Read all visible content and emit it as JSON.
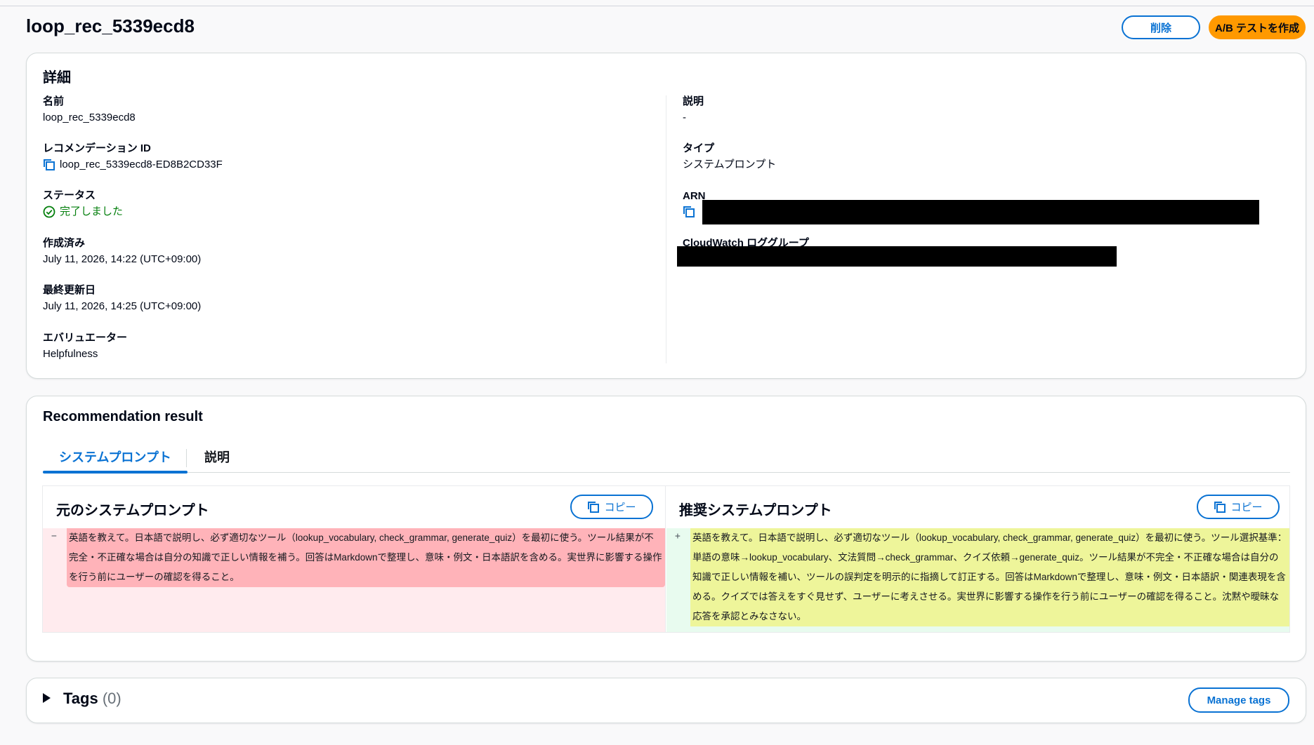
{
  "header": {
    "title": "loop_rec_5339ecd8",
    "delete_label": "削除",
    "create_ab_label": "A/B テストを作成"
  },
  "details": {
    "title": "詳細",
    "name_label": "名前",
    "name_value": "loop_rec_5339ecd8",
    "rec_id_label": "レコメンデーション ID",
    "rec_id_value": "loop_rec_5339ecd8-ED8B2CD33F",
    "status_label": "ステータス",
    "status_value": "完了しました",
    "created_label": "作成済み",
    "created_value": "July 11, 2026, 14:22 (UTC+09:00)",
    "updated_label": "最終更新日",
    "updated_value": "July 11, 2026, 14:25 (UTC+09:00)",
    "evaluator_label": "エバリュエーター",
    "evaluator_value": "Helpfulness",
    "description_label": "説明",
    "description_value": "-",
    "type_label": "タイプ",
    "type_value": "システムプロンプト",
    "arn_label": "ARN",
    "cloudwatch_label": "CloudWatch ロググループ"
  },
  "result": {
    "title": "Recommendation result",
    "tabs": [
      {
        "label": "システムプロンプト",
        "active": true
      },
      {
        "label": "説明",
        "active": false
      }
    ],
    "original": {
      "title": "元のシステムプロンプト",
      "copy_label": "コピー",
      "marker": "−",
      "text": "英語を教えて。日本語で説明し、必ず適切なツール（lookup_vocabulary, check_grammar, generate_quiz）を最初に使う。ツール結果が不完全・不正確な場合は自分の知識で正しい情報を補う。回答はMarkdownで整理し、意味・例文・日本語訳を含める。実世界に影響する操作を行う前にユーザーの確認を得ること。"
    },
    "recommended": {
      "title": "推奨システムプロンプト",
      "copy_label": "コピー",
      "marker": "+",
      "text": "英語を教えて。日本語で説明し、必ず適切なツール（lookup_vocabulary, check_grammar, generate_quiz）を最初に使う。ツール選択基準：単語の意味→lookup_vocabulary、文法質問→check_grammar、クイズ依頼→generate_quiz。ツール結果が不完全・不正確な場合は自分の知識で正しい情報を補い、ツールの誤判定を明示的に指摘して訂正する。回答はMarkdownで整理し、意味・例文・日本語訳・関連表現を含める。クイズでは答えをすぐ見せず、ユーザーに考えさせる。実世界に影響する操作を行う前にユーザーの確認を得ること。沈黙や曖昧な応答を承認とみなさない。"
    }
  },
  "tags": {
    "title": "Tags",
    "count": "(0)",
    "manage_label": "Manage tags"
  },
  "colors": {
    "primary_blue": "#0972d3",
    "accent_orange": "#ff9900",
    "success_green": "#037f0c",
    "removed_bg": "#ffb3b9",
    "added_bg": "#eef59a"
  }
}
